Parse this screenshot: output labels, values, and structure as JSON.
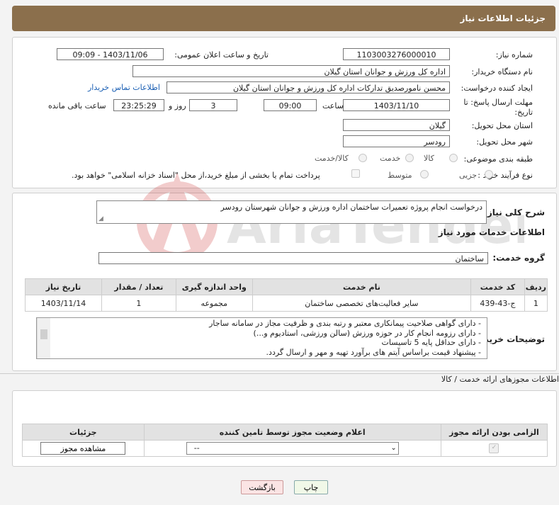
{
  "header": {
    "title": "جزئیات اطلاعات نیاز"
  },
  "form": {
    "need_number": {
      "label": "شماره نیاز:",
      "value": "1103003276000010"
    },
    "announce_datetime": {
      "label": "تاریخ و ساعت اعلان عمومی:",
      "value": "1403/11/06 - 09:09"
    },
    "buyer_org": {
      "label": "نام دستگاه خریدار:",
      "value": "اداره کل ورزش و جوانان استان گیلان"
    },
    "requester": {
      "label": "ایجاد کننده درخواست:",
      "value": "محسن نامورصدیق تدارکات اداره کل ورزش و جوانان استان گیلان"
    },
    "contact_link": "اطلاعات تماس خریدار",
    "deadline": {
      "label_line1": "مهلت ارسال پاسخ: تا",
      "label_line2": "تاریخ:",
      "date": "1403/11/10",
      "time_label": "ساعت",
      "time": "09:00",
      "days": "3",
      "days_label": "روز و",
      "remaining": "23:25:29",
      "remaining_label": "ساعت باقی مانده"
    },
    "delivery_province": {
      "label": "استان محل تحویل:",
      "value": "گیلان"
    },
    "delivery_city": {
      "label": "شهر محل تحویل:",
      "value": "رودسر"
    },
    "category": {
      "label": "طبقه بندی موضوعی:",
      "options": [
        "کالا",
        "خدمت",
        "کالا/خدمت"
      ]
    },
    "process_type": {
      "label": "نوع فرآیند خرید :",
      "options": [
        "جزیی",
        "متوسط"
      ],
      "payment_note": "پرداخت تمام یا بخشی از مبلغ خرید،از محل \"اسناد خزانه اسلامی\" خواهد بود."
    }
  },
  "summary": {
    "label": "شرح کلی نیاز:",
    "value": "درخواست انجام پروژه تعمیرات ساختمان اداره ورزش و جوانان شهرستان رودسر"
  },
  "services": {
    "title": "اطلاعات خدمات مورد نیاز",
    "group_label": "گروه خدمت:",
    "group_value": "ساختمان",
    "columns": [
      "ردیف",
      "کد خدمت",
      "نام خدمت",
      "واحد اندازه گیری",
      "تعداد / مقدار",
      "تاریخ نیاز"
    ],
    "rows": [
      {
        "index": "1",
        "code": "ج-43-439",
        "name": "سایر فعالیت‌های تخصصی ساختمان",
        "unit": "مجموعه",
        "qty": "1",
        "date": "1403/11/14"
      }
    ]
  },
  "buyer_notes": {
    "label": "توضیحات خریدار:",
    "lines": [
      "-  دارای گواهی صلاحیت پیمانکاری معتبر و رتبه بندی و ظرفیت مجاز در سامانه ساجار",
      "- دارای رزومه انجام کار در حوزه ورزش (سالن ورزشی، استادیوم و...)",
      "- دارای حداقل پایه 5 تاسیسات",
      "- پیشنهاد قیمت براساس آیتم های برآورد تهیه و مهر و ارسال گردد."
    ]
  },
  "permits": {
    "title": "اطلاعات مجوزهای ارائه خدمت / کالا",
    "columns": [
      "الزامی بودن ارائه مجوز",
      "اعلام وضعیت مجوز توسط تامین کننده",
      "جزئیات"
    ],
    "select_value": "--",
    "view_button": "مشاهده مجوز"
  },
  "buttons": {
    "print": "چاپ",
    "back": "بازگشت"
  },
  "watermark": {
    "text": "AriaTender.neT"
  }
}
